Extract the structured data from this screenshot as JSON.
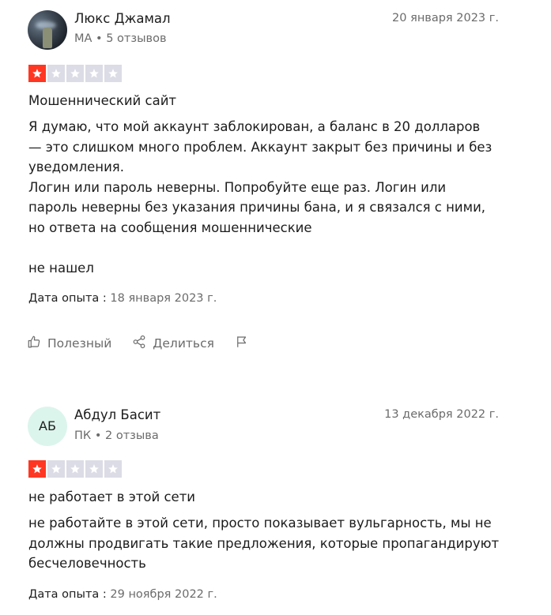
{
  "reviews": [
    {
      "author": "Люкс Джамал",
      "initials": "",
      "avatar_type": "photo",
      "country": "MA",
      "reviews_count": "5 отзывов",
      "date": "20 января 2023 г.",
      "rating": 1,
      "title": "Мошеннический сайт",
      "body": "Я думаю, что мой аккаунт заблокирован, а баланс в 20 долларов\n— это слишком много проблем. Аккаунт закрыт без причины и без\nуведомления.\nЛогин или пароль неверны. Попробуйте еще раз. Логин или\nпароль неверны без указания причины бана, и я связался с ними,\nно ответа на сообщения мошеннические\n\nне нашел",
      "experience_label": "Дата опыта :",
      "experience_date": "18 января 2023 г.",
      "actions": {
        "useful_label": "Полезный",
        "share_label": "Делиться"
      }
    },
    {
      "author": "Абдул Басит",
      "initials": "АБ",
      "avatar_type": "initials",
      "country": "ПК",
      "reviews_count": "2 отзыва",
      "date": "13 декабря 2022 г.",
      "rating": 1,
      "title": "не работает в этой сети",
      "body": "не работайте в этой сети, просто показывает вульгарность, мы не\nдолжны продвигать такие предложения, которые пропагандируют\nбесчеловечность",
      "experience_label": "Дата опыта :",
      "experience_date": "29 ноября 2022 г."
    }
  ],
  "meta_separator": "•",
  "colors": {
    "star_filled": "#ff3722",
    "star_empty": "#dcdce6",
    "initials_avatar_bg": "#dcf5ec",
    "muted_text": "#6b6b6b"
  },
  "icons": {
    "useful": "thumbs-up-icon",
    "share": "share-icon",
    "report": "flag-icon",
    "star": "star-icon"
  }
}
